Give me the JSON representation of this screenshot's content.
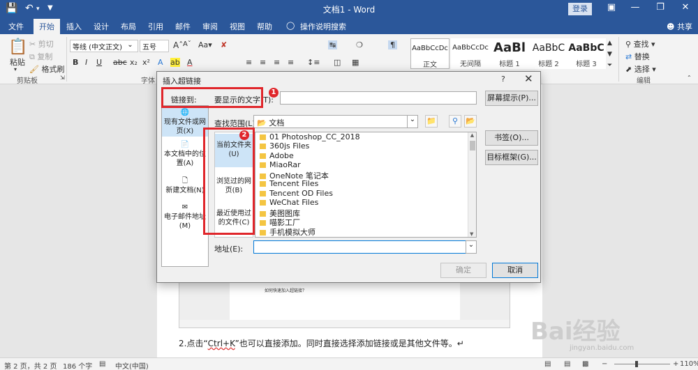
{
  "window": {
    "title": "文档1 - Word",
    "login": "登录",
    "share": "共享",
    "accent": "#2b579a"
  },
  "tabs": [
    "文件",
    "开始",
    "插入",
    "设计",
    "布局",
    "引用",
    "邮件",
    "审阅",
    "视图",
    "帮助",
    "操作说明搜索"
  ],
  "ribbon": {
    "clipboard": {
      "paste": "粘贴",
      "cut": "剪切",
      "copy": "复制",
      "painter": "格式刷",
      "label": "剪贴板"
    },
    "font": {
      "name": "等线 (中文正文)",
      "size": "五号",
      "label": "字体"
    },
    "styles": [
      {
        "sample": "AaBbCcDc",
        "name": "正文"
      },
      {
        "sample": "AaBbCcDc",
        "name": "无间隔"
      },
      {
        "sample": "AaBl",
        "name": "标题 1"
      },
      {
        "sample": "AaBbC",
        "name": "标题 2"
      },
      {
        "sample": "AaBbC",
        "name": "标题 3"
      }
    ],
    "editing": {
      "find": "查找",
      "replace": "替换",
      "select": "选择",
      "label": "编辑"
    }
  },
  "dialog": {
    "title": "插入超链接",
    "help": "?",
    "link_to": "链接到:",
    "display_text_label": "要显示的文字(T):",
    "screen_tip": "屏幕提示(P)...",
    "look_in_label": "查找范围(L):",
    "look_in_value": "文档",
    "bookmark": "书签(O)...",
    "target_frame": "目标框架(G)...",
    "address_label": "地址(E):",
    "ok": "确定",
    "cancel": "取消",
    "side_items": [
      "现有文件或网页(X)",
      "本文档中的位置(A)",
      "新建文档(N)",
      "电子邮件地址(M)"
    ],
    "sub_items": [
      "当前文件夹(U)",
      "浏览过的网页(B)",
      "最近使用过的文件(C)"
    ],
    "files": [
      "01 Photoshop_CC_2018",
      "360js Files",
      "Adobe",
      "MiaoRar",
      "OneNote 笔记本",
      "Tencent Files",
      "Tencent OD Files",
      "WeChat Files",
      "美图图库",
      "喵影工厂",
      "手机模拟大师"
    ],
    "badges": [
      "1",
      "2"
    ],
    "highlight": "#e0262b"
  },
  "document": {
    "inner_text": "如何快速加入超链接？",
    "line_before": "2.点击“",
    "line_key": "Ctrl+K",
    "line_after": "”也可以直接添加。同时直接选择添加链接或是其他文件等。↵"
  },
  "status": {
    "pages": "第 2 页，共 2 页",
    "words": "186 个字",
    "lang": "中文(中国)",
    "zoom": "110%"
  },
  "watermark": {
    "brand": "Bai经验",
    "url": "jingyan.baidu.com"
  }
}
